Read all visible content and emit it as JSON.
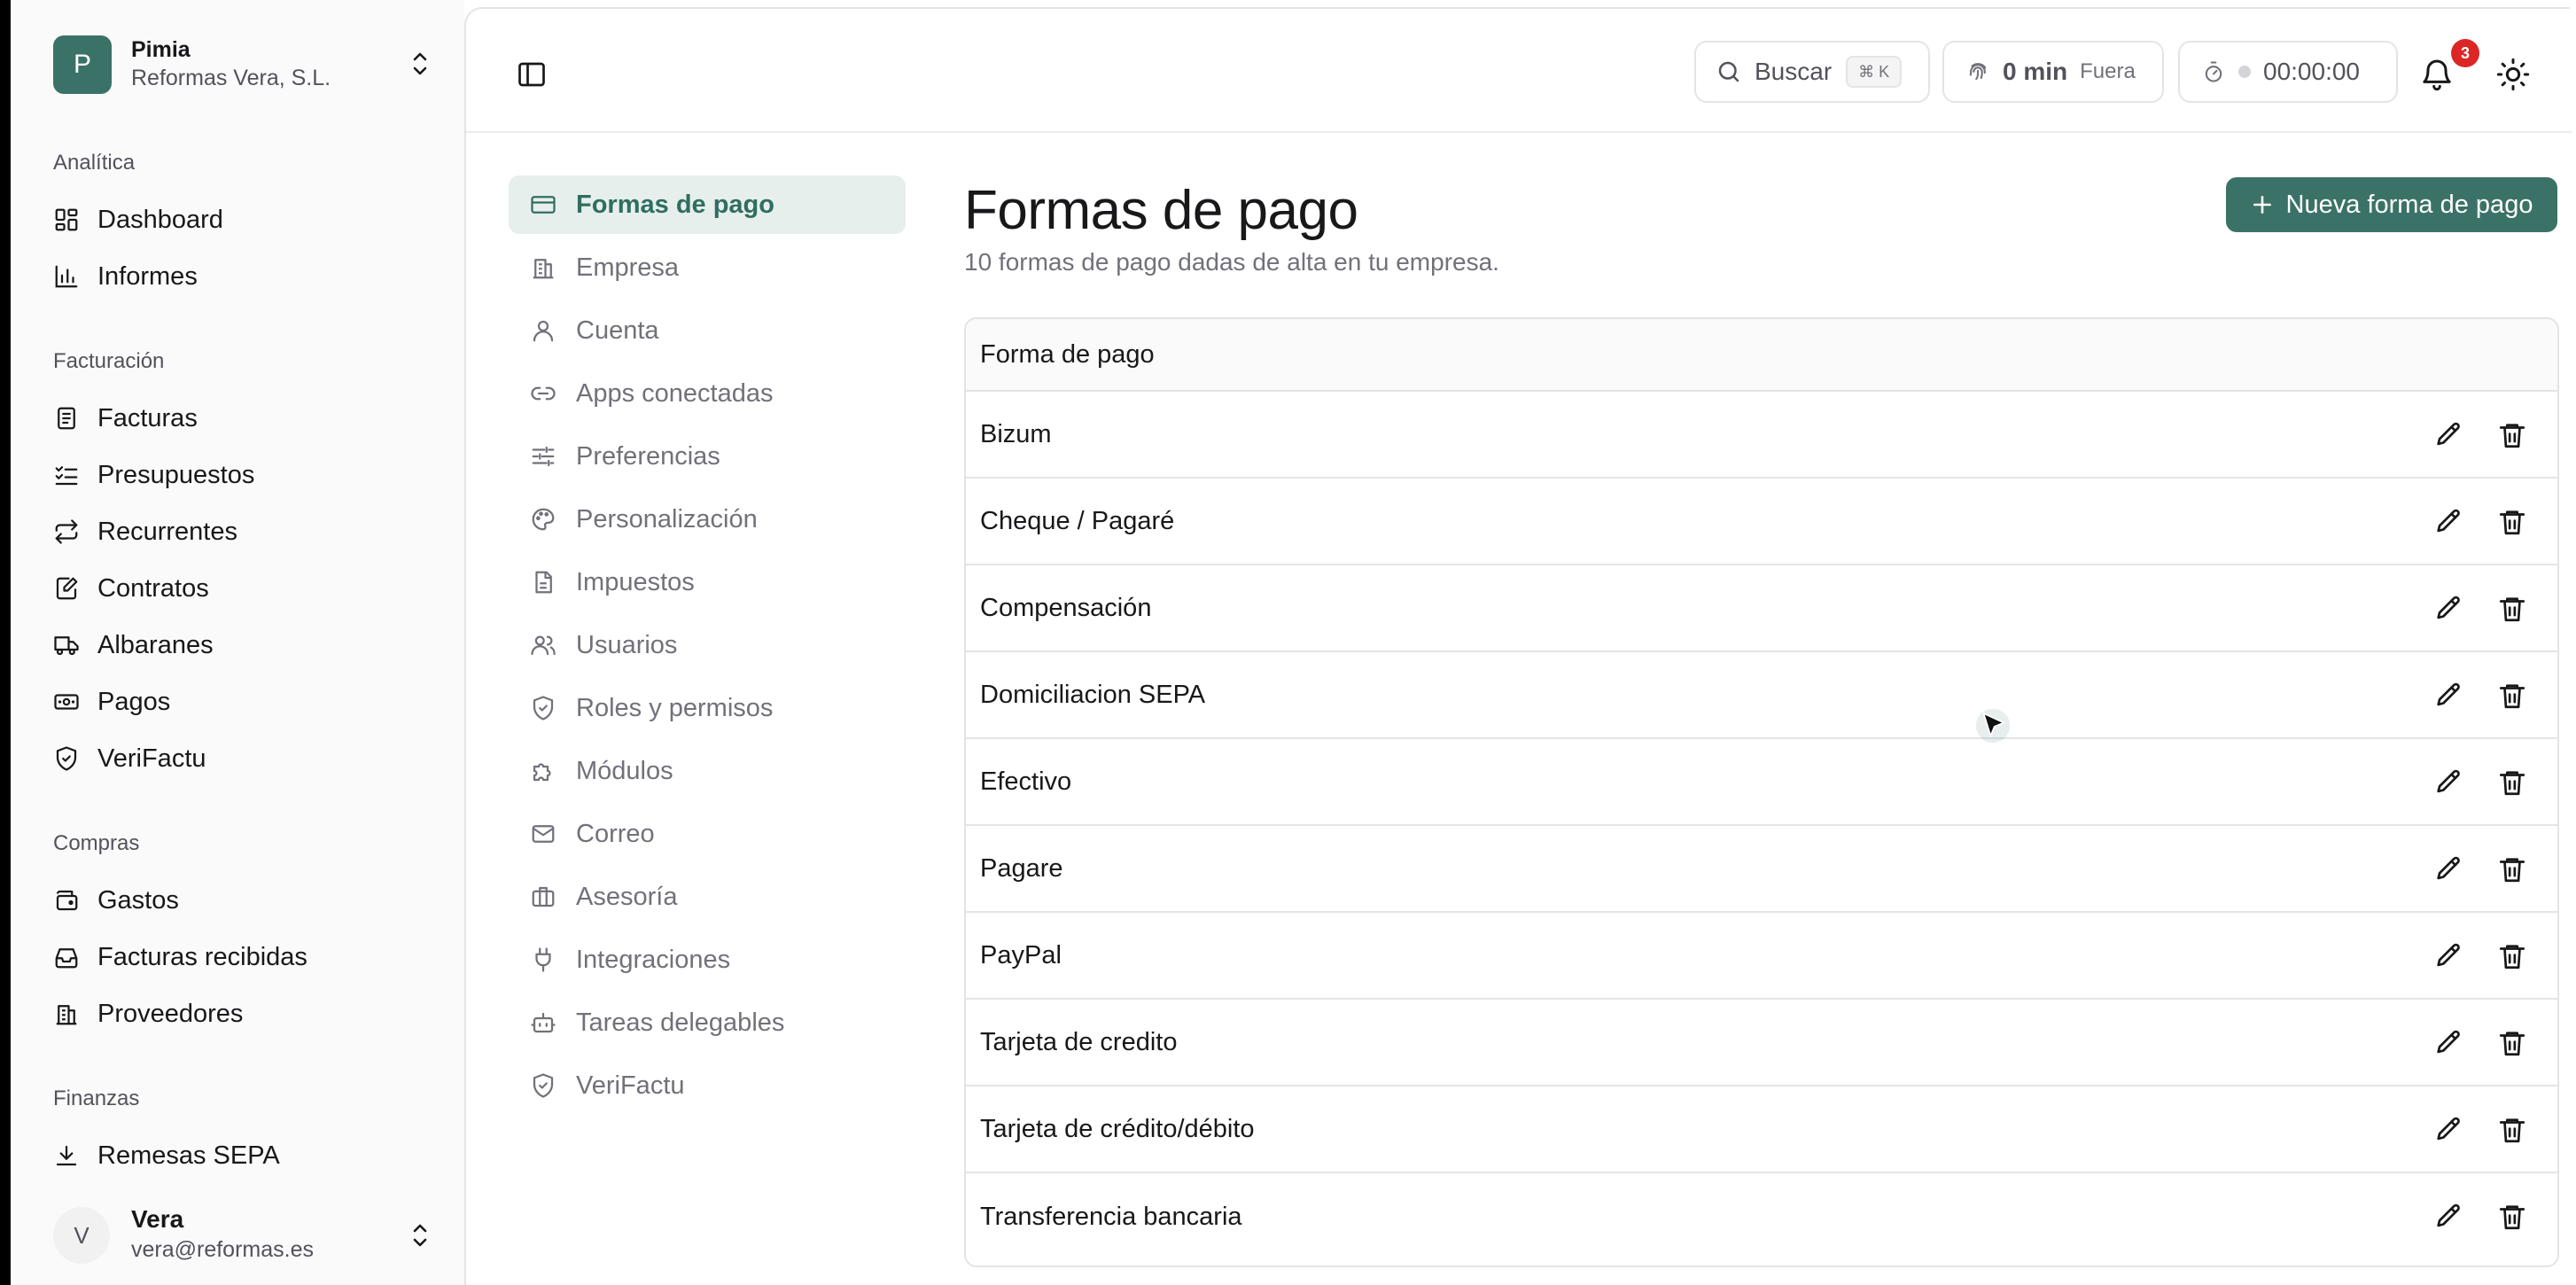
{
  "org": {
    "initial": "P",
    "name": "Pimia",
    "company": "Reformas Vera, S.L."
  },
  "sidebar": {
    "sections": [
      {
        "label": "Analítica",
        "items": [
          {
            "label": "Dashboard",
            "icon": "dashboard-icon"
          },
          {
            "label": "Informes",
            "icon": "bar-chart-icon"
          }
        ]
      },
      {
        "label": "Facturación",
        "items": [
          {
            "label": "Facturas",
            "icon": "invoice-icon"
          },
          {
            "label": "Presupuestos",
            "icon": "list-check-icon"
          },
          {
            "label": "Recurrentes",
            "icon": "repeat-icon"
          },
          {
            "label": "Contratos",
            "icon": "contract-icon"
          },
          {
            "label": "Albaranes",
            "icon": "truck-icon"
          },
          {
            "label": "Pagos",
            "icon": "banknote-icon"
          },
          {
            "label": "VeriFactu",
            "icon": "shield-check-icon"
          }
        ]
      },
      {
        "label": "Compras",
        "items": [
          {
            "label": "Gastos",
            "icon": "wallet-icon"
          },
          {
            "label": "Facturas recibidas",
            "icon": "inbox-icon"
          },
          {
            "label": "Proveedores",
            "icon": "building-icon"
          }
        ]
      },
      {
        "label": "Finanzas",
        "items": [
          {
            "label": "Remesas SEPA",
            "icon": "download-icon"
          }
        ]
      }
    ]
  },
  "user": {
    "initial": "V",
    "name": "Vera",
    "email": "vera@reformas.es"
  },
  "header": {
    "search_label": "Buscar",
    "search_shortcut": "⌘ K",
    "time_value": "0 min",
    "time_status": "Fuera",
    "timer": "00:00:00",
    "notifications_count": "3"
  },
  "settings_nav": [
    {
      "label": "Formas de pago",
      "icon": "credit-card-icon",
      "active": true
    },
    {
      "label": "Empresa",
      "icon": "building-icon"
    },
    {
      "label": "Cuenta",
      "icon": "user-icon"
    },
    {
      "label": "Apps conectadas",
      "icon": "link-icon"
    },
    {
      "label": "Preferencias",
      "icon": "sliders-icon"
    },
    {
      "label": "Personalización",
      "icon": "palette-icon"
    },
    {
      "label": "Impuestos",
      "icon": "document-icon"
    },
    {
      "label": "Usuarios",
      "icon": "users-icon"
    },
    {
      "label": "Roles y permisos",
      "icon": "shield-icon"
    },
    {
      "label": "Módulos",
      "icon": "puzzle-icon"
    },
    {
      "label": "Correo",
      "icon": "mail-icon"
    },
    {
      "label": "Asesoría",
      "icon": "briefcase-icon"
    },
    {
      "label": "Integraciones",
      "icon": "plug-icon"
    },
    {
      "label": "Tareas delegables",
      "icon": "bot-icon"
    },
    {
      "label": "VeriFactu",
      "icon": "shield-check-icon"
    }
  ],
  "page": {
    "title": "Formas de pago",
    "subtitle": "10 formas de pago dadas de alta en tu empresa.",
    "new_button": "Nueva forma de pago",
    "column_header": "Forma de pago",
    "rows": [
      "Bizum",
      "Cheque / Pagaré",
      "Compensación",
      "Domiciliacion SEPA",
      "Efectivo",
      "Pagare",
      "PayPal",
      "Tarjeta de credito",
      "Tarjeta de crédito/débito",
      "Transferencia bancaria"
    ]
  },
  "colors": {
    "accent": "#3b7267",
    "active_bg": "#e7efec",
    "badge": "#dc2626"
  }
}
